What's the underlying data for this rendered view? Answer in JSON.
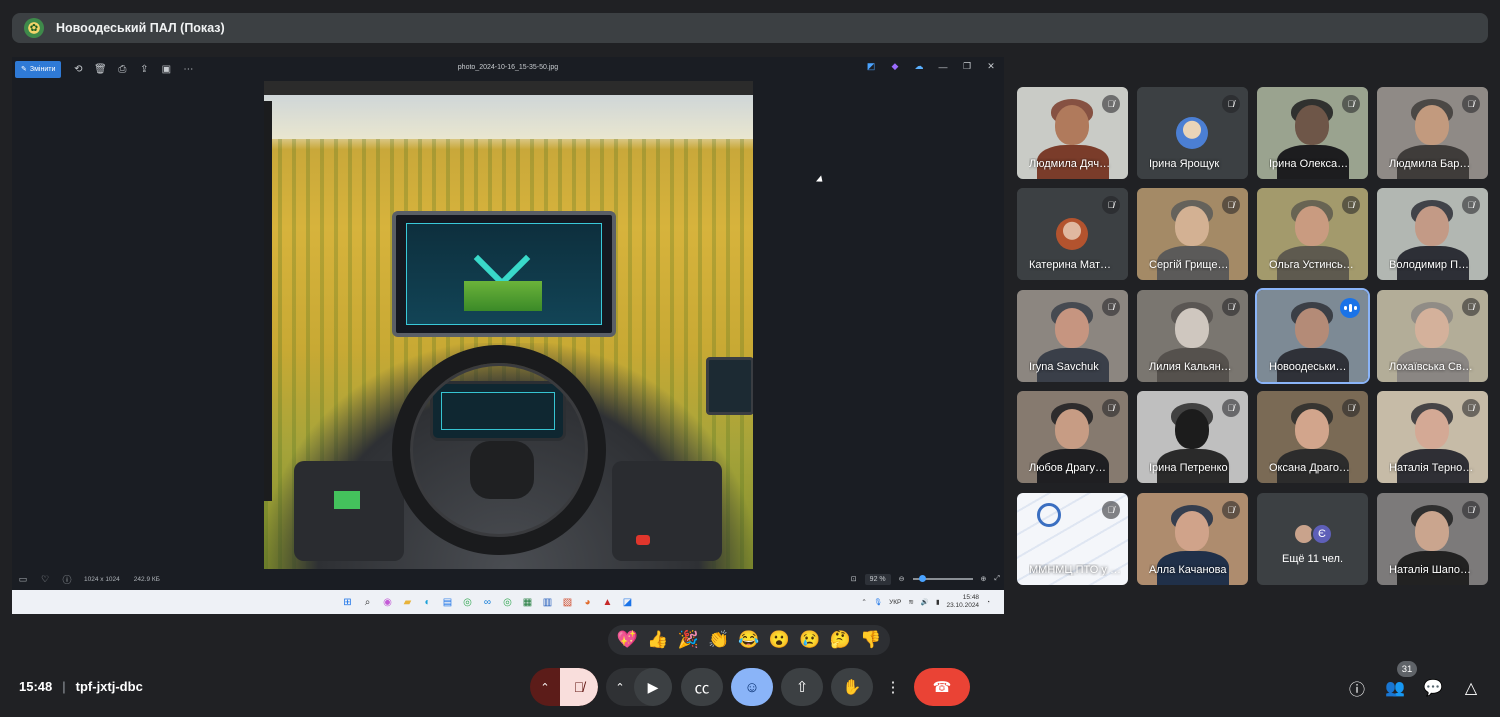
{
  "presenter": {
    "title": "Новоодеський ПАЛ (Показ)"
  },
  "viewer": {
    "edit_label": "Змінити",
    "file_name": "photo_2024-10-16_15-35-50.jpg",
    "dimensions": "1024 x 1024",
    "file_size": "242.9 КБ",
    "zoom": "92 %"
  },
  "tray": {
    "lang": "УКР",
    "time": "15:48",
    "date": "23.10.2024"
  },
  "participants": [
    {
      "name": "Людмила Дяч…",
      "muted": true
    },
    {
      "name": "Ірина Ярощук",
      "muted": true
    },
    {
      "name": "Ірина Олекса…",
      "muted": true
    },
    {
      "name": "Людмила Бар…",
      "muted": true
    },
    {
      "name": "Катерина Мат…",
      "muted": true
    },
    {
      "name": "Сергій Грище…",
      "muted": true
    },
    {
      "name": "Ольга Устинсь…",
      "muted": true
    },
    {
      "name": "Володимир П…",
      "muted": true
    },
    {
      "name": "Iryna Savchuk",
      "muted": true
    },
    {
      "name": "Лилия Кальян…",
      "muted": true
    },
    {
      "name": "Новоодеськи…",
      "muted": false
    },
    {
      "name": "Лохаївська Св…",
      "muted": true
    },
    {
      "name": "Любов Драгу…",
      "muted": true
    },
    {
      "name": "Ірина Петренко",
      "muted": true
    },
    {
      "name": "Оксана Драго…",
      "muted": true
    },
    {
      "name": "Наталія Терно…",
      "muted": true
    },
    {
      "name": "ММНМЦ ПТО у М…",
      "muted": true
    },
    {
      "name": "Алла Качанова",
      "muted": true
    },
    {
      "name": "Наталія Шапо…",
      "muted": true
    }
  ],
  "more_tile": {
    "label": "Ещё 11 чел.",
    "initial": "Є"
  },
  "reactions": [
    "💖",
    "👍",
    "🎉",
    "👏",
    "😂",
    "😮",
    "😢",
    "🤔",
    "👎"
  ],
  "meeting": {
    "time": "15:48",
    "separator": "|",
    "code": "tpf-jxtj-dbc"
  },
  "people_count": "31",
  "colors": {
    "background": "#202124",
    "leave": "#ea4335",
    "emoji_active": "#8ab4f8",
    "speaking": "#1a73e8",
    "mic_muted_bg": "#f9dedc"
  }
}
